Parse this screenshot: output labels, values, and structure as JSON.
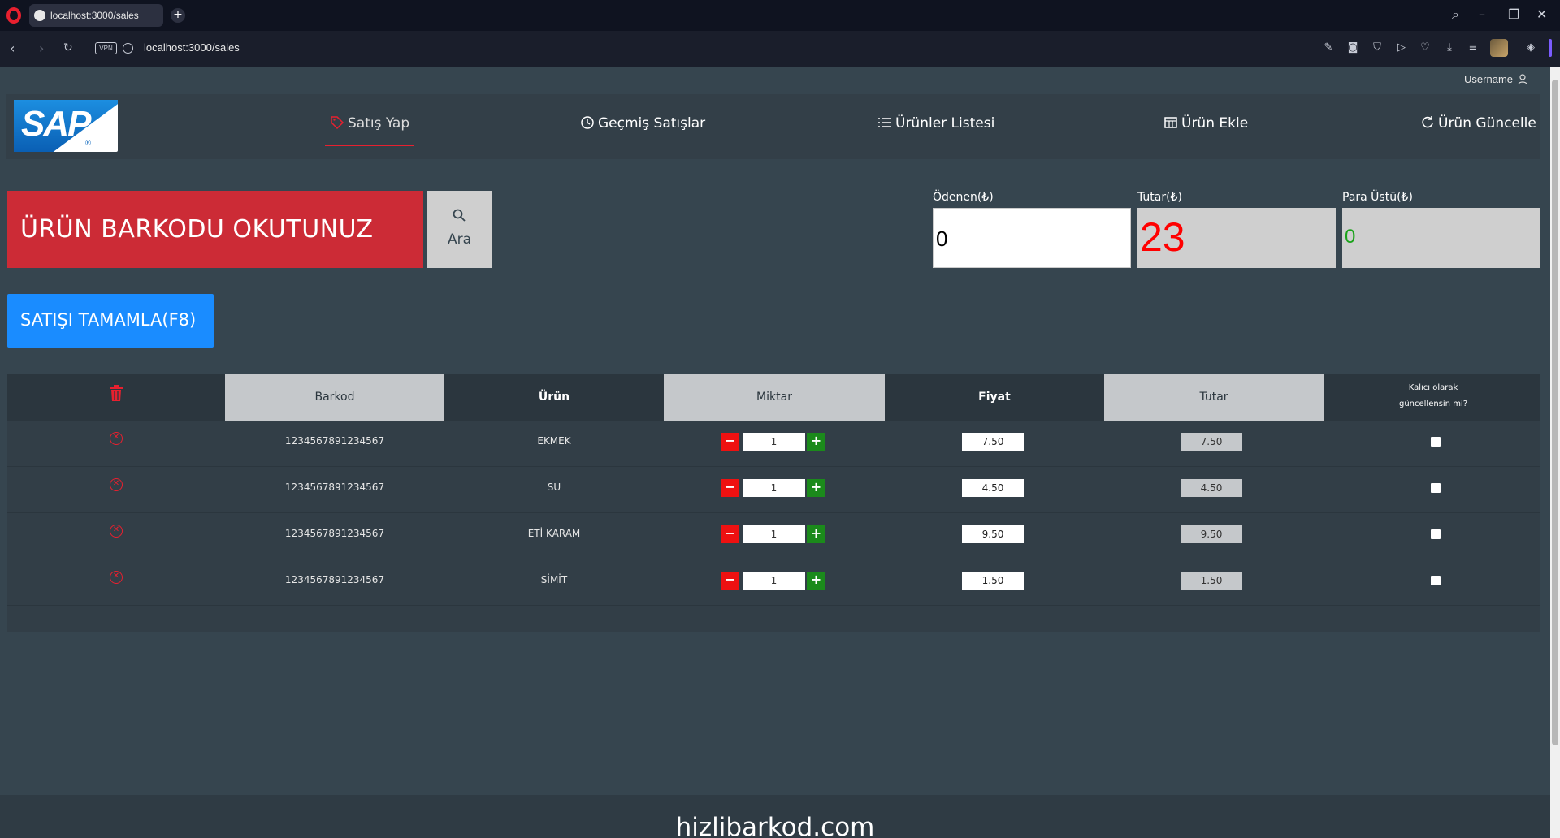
{
  "browser": {
    "tab_title": "localhost:3000/sales",
    "url": "localhost:3000/sales",
    "vpn_label": "VPN"
  },
  "header": {
    "username": "Username"
  },
  "nav": {
    "items": [
      {
        "label": "Satış Yap",
        "icon": "tag-icon",
        "active": true
      },
      {
        "label": "Geçmiş Satışlar",
        "icon": "history-icon",
        "active": false
      },
      {
        "label": "Ürünler Listesi",
        "icon": "list-icon",
        "active": false
      },
      {
        "label": "Ürün Ekle",
        "icon": "table-icon",
        "active": false
      },
      {
        "label": "Ürün Güncelle",
        "icon": "refresh-icon",
        "active": false
      }
    ]
  },
  "logo": {
    "text": "SAP"
  },
  "scan": {
    "prompt": "ÜRÜN BARKODU OKUTUNUZ",
    "search_label": "Ara"
  },
  "summary": {
    "paid_label": "Ödenen(₺)",
    "paid_value": "0",
    "total_label": "Tutar(₺)",
    "total_value": "23",
    "change_label": "Para Üstü(₺)",
    "change_value": "0"
  },
  "actions": {
    "complete_label": "SATIŞI TAMAMLA(F8)"
  },
  "table": {
    "headers": {
      "barcode": "Barkod",
      "product": "Ürün",
      "quantity": "Miktar",
      "price": "Fiyat",
      "total": "Tutar",
      "persist_line1": "Kalıcı olarak",
      "persist_line2": "güncellensin mi?"
    },
    "rows": [
      {
        "barcode": "1234567891234567",
        "product": "EKMEK",
        "quantity": "1",
        "price": "7.50",
        "total": "7.50"
      },
      {
        "barcode": "1234567891234567",
        "product": "SU",
        "quantity": "1",
        "price": "4.50",
        "total": "4.50"
      },
      {
        "barcode": "1234567891234567",
        "product": "ETİ KARAM",
        "quantity": "1",
        "price": "9.50",
        "total": "9.50"
      },
      {
        "barcode": "1234567891234567",
        "product": "SİMİT",
        "quantity": "1",
        "price": "1.50",
        "total": "1.50"
      }
    ]
  },
  "footer": {
    "text": "hizlibarkod.com"
  },
  "colors": {
    "background": "#36454f",
    "scan_red": "#cc2b36",
    "complete_blue": "#1a8cff",
    "total_red": "#ff0000",
    "change_green": "#1aa31a"
  }
}
